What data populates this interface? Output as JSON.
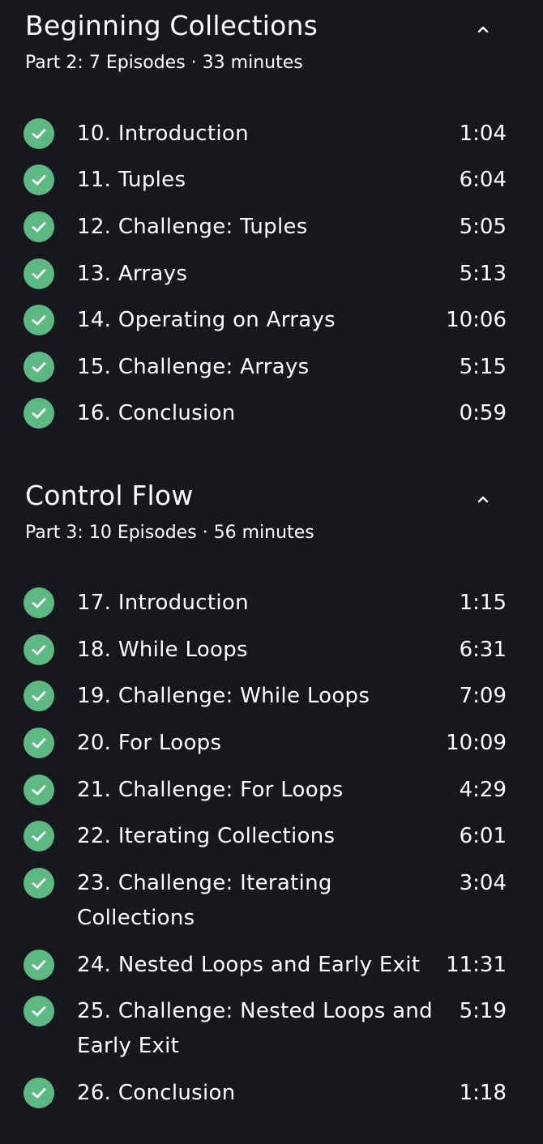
{
  "sections": [
    {
      "title": "Beginning Collections",
      "meta": "Part 2: 7 Episodes · 33 minutes",
      "collapse_icon": "chevron-up-icon",
      "episodes": [
        {
          "title": "10. Introduction",
          "duration": "1:04",
          "completed": true
        },
        {
          "title": "11. Tuples",
          "duration": "6:04",
          "completed": true
        },
        {
          "title": "12. Challenge: Tuples",
          "duration": "5:05",
          "completed": true
        },
        {
          "title": "13. Arrays",
          "duration": "5:13",
          "completed": true
        },
        {
          "title": "14. Operating on Arrays",
          "duration": "10:06",
          "completed": true
        },
        {
          "title": "15. Challenge: Arrays",
          "duration": "5:15",
          "completed": true
        },
        {
          "title": "16. Conclusion",
          "duration": "0:59",
          "completed": true
        }
      ]
    },
    {
      "title": "Control Flow",
      "meta": "Part 3: 10 Episodes · 56 minutes",
      "collapse_icon": "chevron-up-icon",
      "episodes": [
        {
          "title": "17. Introduction",
          "duration": "1:15",
          "completed": true
        },
        {
          "title": "18. While Loops",
          "duration": "6:31",
          "completed": true
        },
        {
          "title": "19. Challenge: While Loops",
          "duration": "7:09",
          "completed": true
        },
        {
          "title": "20. For Loops",
          "duration": "10:09",
          "completed": true
        },
        {
          "title": "21. Challenge: For Loops",
          "duration": "4:29",
          "completed": true
        },
        {
          "title": "22. Iterating Collections",
          "duration": "6:01",
          "completed": true
        },
        {
          "title": "23. Challenge: Iterating Collections",
          "duration": "3:04",
          "completed": true
        },
        {
          "title": "24. Nested Loops and Early Exit",
          "duration": "11:31",
          "completed": true
        },
        {
          "title": "25. Challenge: Nested Loops and Early Exit",
          "duration": "5:19",
          "completed": true
        },
        {
          "title": "26. Conclusion",
          "duration": "1:18",
          "completed": true
        }
      ]
    }
  ],
  "colors": {
    "background": "#16181d",
    "check": "#5db982",
    "text": "#ffffff"
  }
}
